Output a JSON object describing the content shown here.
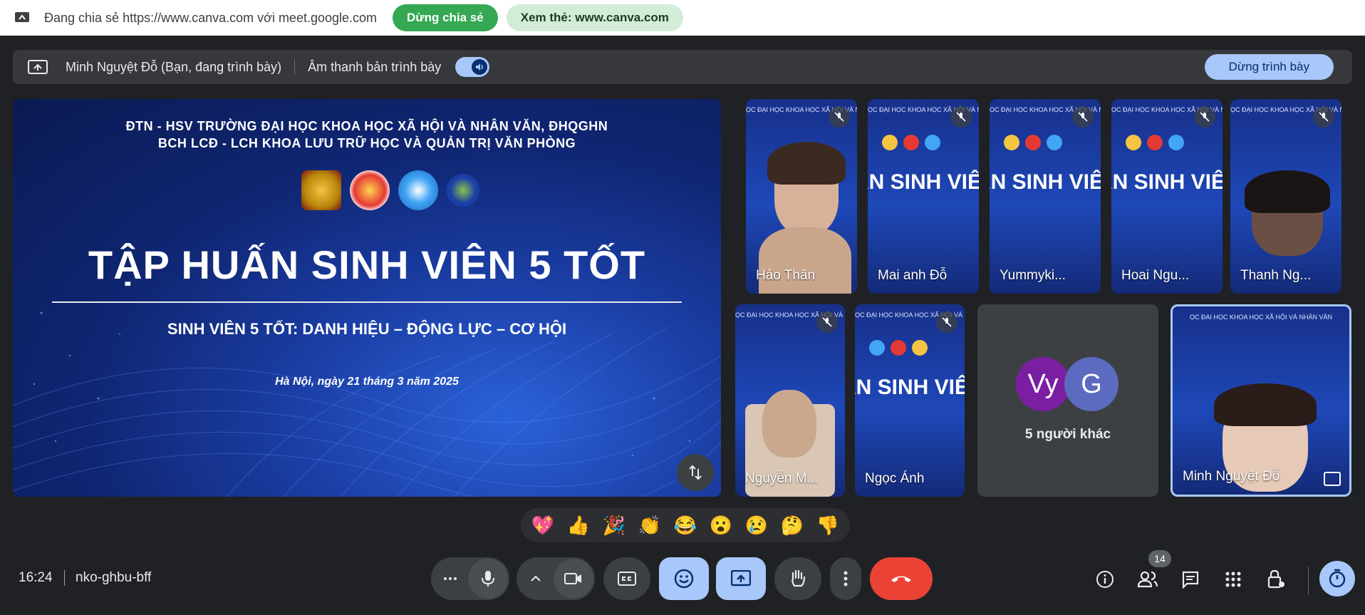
{
  "share_banner": {
    "text": "Đang chia sẻ https://www.canva.com với meet.google.com",
    "stop_label": "Dừng chia sẻ",
    "view_label": "Xem thẻ: www.canva.com"
  },
  "present_bar": {
    "presenter": "Minh Nguyệt Đỗ (Bạn, đang trình bày)",
    "audio_label": "Âm thanh bản trình bày",
    "audio_on": true,
    "stop_label": "Dừng trình bày"
  },
  "slide": {
    "header_line1": "ĐTN - HSV TRƯỜNG ĐẠI HỌC KHOA HỌC XÃ HỘI VÀ NHÂN VĂN, ĐHQGHN",
    "header_line2": "BCH LCĐ - LCH KHOA LƯU TRỮ HỌC VÀ QUẢN TRỊ VĂN PHÒNG",
    "title": "TẬP HUẤN SINH VIÊN 5 TỐT",
    "subtitle": "SINH VIÊN 5 TỐT: DANH HIỆU – ĐỘNG LỰC – CƠ HỘI",
    "date": "Hà Nội, ngày 21 tháng 3 năm 2025"
  },
  "tiles": {
    "mini_header": "ỌC ĐẠI HỌC KHOA HỌC XÃ HỘI VÀ NHÂN VĂN",
    "mini_big": "ẤN SINH VIÊ",
    "t1": "Hảo Thân",
    "t2": "Mai anh Đỗ",
    "t3": "Yummyki...",
    "t4": "Hoai Ngu...",
    "t5": "Thanh Ng...",
    "t6": "Nguyễn M...",
    "t7": "Ngọc Ánh",
    "others_label": "5 người khác",
    "avatar1": "Vy",
    "avatar2": "G",
    "self": "Minh Nguyệt Đỗ"
  },
  "reactions": [
    "💖",
    "👍",
    "🎉",
    "👏",
    "😂",
    "😮",
    "😢",
    "🤔",
    "👎"
  ],
  "bottom": {
    "time": "16:24",
    "meeting_code": "nko-ghbu-bff",
    "participants_count": "14"
  },
  "colors": {
    "accent": "#a8c7fa",
    "end_call": "#ea4335",
    "share_green": "#34a853",
    "background": "#202124"
  }
}
